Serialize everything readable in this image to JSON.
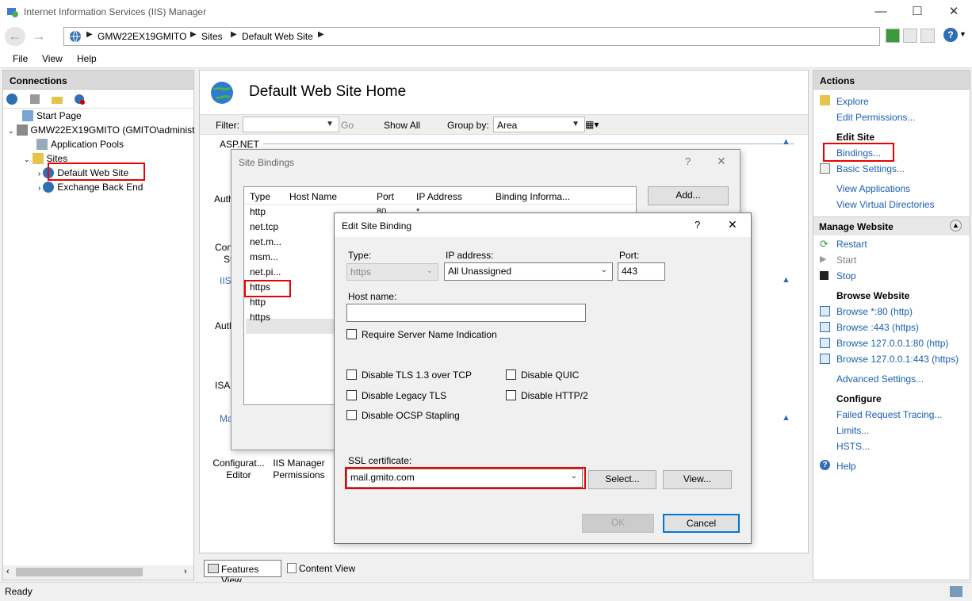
{
  "window": {
    "title": "Internet Information Services (IIS) Manager"
  },
  "address": {
    "crumbs": [
      "GMW22EX19GMITO",
      "Sites",
      "Default Web Site"
    ]
  },
  "menu": [
    "File",
    "View",
    "Help"
  ],
  "connections": {
    "header": "Connections",
    "tree": {
      "start_page": "Start Page",
      "server": "GMW22EX19GMITO (GMITO\\administ",
      "app_pools": "Application Pools",
      "sites": "Sites",
      "default_site": "Default Web Site",
      "exchange_back_end": "Exchange Back End"
    }
  },
  "center": {
    "title": "Default Web Site Home",
    "filter_label": "Filter:",
    "go_label": "Go",
    "show_all_label": "Show All",
    "group_by_label": "Group by:",
    "group_by_value": "Area",
    "section_aspnet": "ASP.NET",
    "partial_auth": "Auth",
    "partial_conf": "Con",
    "partial_st": "St",
    "partial_iis": "IIS",
    "partial_auth2": "Auth",
    "partial_isap": "ISAP",
    "partial_ma": "Ma",
    "config_editor": "Configurat... Editor",
    "iis_perms": "IIS Manager Permissions",
    "features_view": "Features View",
    "content_view": "Content View"
  },
  "site_bindings": {
    "title": "Site Bindings",
    "help": "?",
    "close": "✕",
    "columns": [
      "Type",
      "Host Name",
      "Port",
      "IP Address",
      "Binding Informa..."
    ],
    "types": [
      "http",
      "net.tcp",
      "net.m...",
      "msm...",
      "net.pi...",
      "https",
      "http",
      "https"
    ],
    "first_port": "80",
    "first_ip": "*",
    "add_button": "Add..."
  },
  "edit_binding": {
    "title": "Edit Site Binding",
    "help": "?",
    "close": "✕",
    "type_label": "Type:",
    "type_value": "https",
    "ip_label": "IP address:",
    "ip_value": "All Unassigned",
    "port_label": "Port:",
    "port_value": "443",
    "host_label": "Host name:",
    "host_value": "",
    "sni_label": "Require Server Name Indication",
    "tls13_label": "Disable TLS 1.3 over TCP",
    "quic_label": "Disable QUIC",
    "legacy_tls_label": "Disable Legacy TLS",
    "http2_label": "Disable HTTP/2",
    "ocsp_label": "Disable OCSP Stapling",
    "ssl_label": "SSL certificate:",
    "ssl_value": "mail.gmito.com",
    "select_button": "Select...",
    "view_button": "View...",
    "ok_button": "OK",
    "cancel_button": "Cancel"
  },
  "actions": {
    "header": "Actions",
    "explore": "Explore",
    "edit_permissions": "Edit Permissions...",
    "edit_site": "Edit Site",
    "bindings": "Bindings...",
    "basic_settings": "Basic Settings...",
    "view_applications": "View Applications",
    "view_vdirs": "View Virtual Directories",
    "manage_website": "Manage Website",
    "restart": "Restart",
    "start": "Start",
    "stop": "Stop",
    "browse_website": "Browse Website",
    "browse_80": "Browse *:80 (http)",
    "browse_443": "Browse :443 (https)",
    "browse_local_80": "Browse 127.0.0.1:80 (http)",
    "browse_local_443": "Browse 127.0.0.1:443 (https)",
    "advanced_settings": "Advanced Settings...",
    "configure": "Configure",
    "failed_tracing": "Failed Request Tracing...",
    "limits": "Limits...",
    "hsts": "HSTS...",
    "help": "Help"
  },
  "status": {
    "text": "Ready"
  },
  "colors": {
    "link": "#1a5fb4",
    "highlight": "#e00000",
    "selected": "#cce8ff"
  }
}
